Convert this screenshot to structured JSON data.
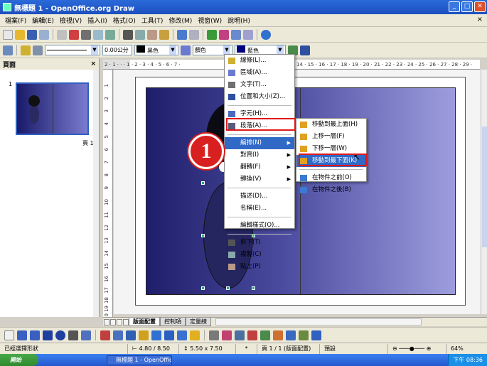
{
  "window": {
    "title": "無標題 1 - OpenOffice.org Draw",
    "doc_close": "×"
  },
  "menubar": [
    "檔案(F)",
    "編輯(E)",
    "檢視(V)",
    "插入(I)",
    "格式(O)",
    "工具(T)",
    "修改(M)",
    "視窗(W)",
    "說明(H)"
  ],
  "toolbar2": {
    "line_width": "0.00公分",
    "line_color": "黑色",
    "area_type": "顏色",
    "area_color": "藍色"
  },
  "panel": {
    "title": "頁面",
    "page_num": "1",
    "page_label": "頁 1"
  },
  "ruler_h": "2 · 1 · · · 1 · 2 · 3 · 4 · 5 · 6 · 7 ·",
  "ruler_h_right": "14 · 15 · 16 · 17 · 18 · 19 · 20 · 21 · 22 · 23 · 24 · 25 · 26 · 27 · 28 · 29 ·",
  "ruler_v": [
    "1",
    "2",
    "3",
    "4",
    "5",
    "6",
    "7",
    "8",
    "9",
    "10",
    "11",
    "12",
    "13",
    "14",
    "15",
    "16",
    "17",
    "18",
    "19",
    "20"
  ],
  "tabs": [
    "版面配置",
    "控制項",
    "定量線"
  ],
  "context_menu": {
    "items": [
      {
        "label": "線條(L)...",
        "icon": "line-icon"
      },
      {
        "label": "區域(A)...",
        "icon": "area-icon"
      },
      {
        "label": "文字(T)...",
        "icon": "text-icon"
      },
      {
        "label": "位置和大小(Z)...",
        "icon": "position-icon"
      },
      {
        "label": "字元(H)...",
        "icon": "character-icon"
      },
      {
        "label": "段落(A)...",
        "icon": "paragraph-icon"
      },
      {
        "label": "編排(N)",
        "icon": "arrange-icon"
      },
      {
        "label": "對齊(I)",
        "icon": ""
      },
      {
        "label": "翻轉(F)",
        "icon": ""
      },
      {
        "label": "轉換(V)",
        "icon": ""
      },
      {
        "label": "描述(D)...",
        "icon": ""
      },
      {
        "label": "名稱(E)...",
        "icon": ""
      },
      {
        "label": "編輯樣式(O)...",
        "icon": ""
      },
      {
        "label": "剪下(T)",
        "icon": "cut-icon"
      },
      {
        "label": "複製(C)",
        "icon": "copy-icon"
      },
      {
        "label": "貼上(P)",
        "icon": "paste-icon"
      }
    ]
  },
  "submenu": {
    "items": [
      {
        "label": "移動到最上面(H)"
      },
      {
        "label": "上移一層(F)"
      },
      {
        "label": "下移一層(W)"
      },
      {
        "label": "移動到最下面(K)"
      },
      {
        "label": "在物件之前(O)"
      },
      {
        "label": "在物件之後(B)"
      }
    ]
  },
  "callout": "1",
  "status": {
    "selection": "已經選擇形狀",
    "position": "4.80 / 8.50",
    "size": "5.50 x 7.50",
    "modified": "*",
    "page": "頁 1 / 1 (版面配置)",
    "style": "預設",
    "zoom": "64%"
  },
  "taskbar": {
    "start": "開始",
    "task": "無標題 1 - OpenOffic...",
    "clock": "下午 08:36"
  },
  "colors": {
    "accent": "#3169c6",
    "highlight_box": "#e01818",
    "title_bar": "#1c4fc0"
  }
}
